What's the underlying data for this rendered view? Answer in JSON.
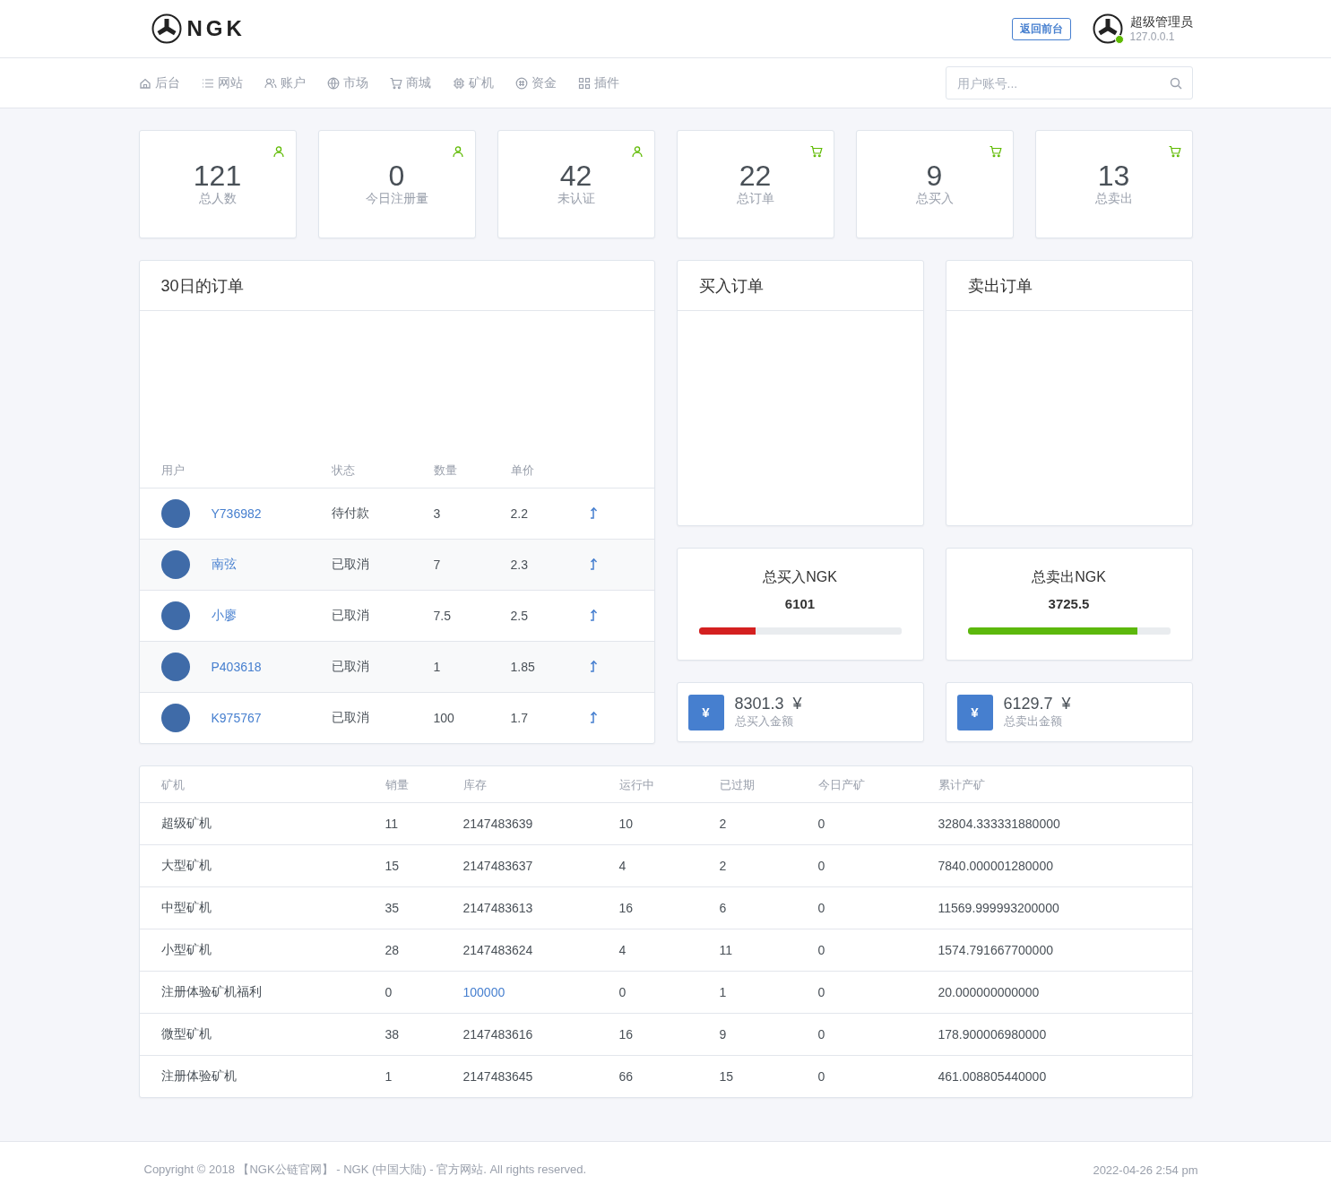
{
  "header": {
    "logo_text": "NGK",
    "back_button": "返回前台",
    "user": {
      "name": "超级管理员",
      "ip": "127.0.0.1",
      "online": true
    }
  },
  "nav": {
    "items": [
      {
        "label": "后台",
        "kind": "home"
      },
      {
        "label": "网站",
        "kind": "list"
      },
      {
        "label": "账户",
        "kind": "users"
      },
      {
        "label": "市场",
        "kind": "globe"
      },
      {
        "label": "商城",
        "kind": "cart"
      },
      {
        "label": "矿机",
        "kind": "chip"
      },
      {
        "label": "资金",
        "kind": "coin"
      },
      {
        "label": "插件",
        "kind": "grid"
      }
    ],
    "search": {
      "placeholder": "用户账号..."
    }
  },
  "stats": [
    {
      "value": "121",
      "label": "总人数",
      "kind": "user"
    },
    {
      "value": "0",
      "label": "今日注册量",
      "kind": "user"
    },
    {
      "value": "42",
      "label": "未认证",
      "kind": "user"
    },
    {
      "value": "22",
      "label": "总订单",
      "kind": "cart"
    },
    {
      "value": "9",
      "label": "总买入",
      "kind": "cart"
    },
    {
      "value": "13",
      "label": "总卖出",
      "kind": "cart"
    }
  ],
  "orders_panel": {
    "title": "30日的订单",
    "columns": [
      "用户",
      "状态",
      "数量",
      "单价"
    ],
    "rows": [
      {
        "user": "Y736982",
        "status": "待付款",
        "quantity": "3",
        "price": "2.2"
      },
      {
        "user": "南弦",
        "status": "已取消",
        "quantity": "7",
        "price": "2.3"
      },
      {
        "user": "小廖",
        "status": "已取消",
        "quantity": "7.5",
        "price": "2.5"
      },
      {
        "user": "P403618",
        "status": "已取消",
        "quantity": "1",
        "price": "1.85"
      },
      {
        "user": "K975767",
        "status": "已取消",
        "quantity": "100",
        "price": "1.7"
      }
    ]
  },
  "side_panels": [
    {
      "title": "买入订单"
    },
    {
      "title": "卖出订单"
    }
  ],
  "totals": [
    {
      "title": "总买入NGK",
      "value": "6101",
      "level": 0.28,
      "color": "#d42020"
    },
    {
      "title": "总卖出NGK",
      "value": "3725.5",
      "level": 0.84,
      "color": "#5cb80c"
    }
  ],
  "amounts": [
    {
      "icon": "¥",
      "value": "8301.3",
      "unit": "¥",
      "label": "总买入金额"
    },
    {
      "icon": "¥",
      "value": "6129.7",
      "unit": "¥",
      "label": "总卖出金额"
    }
  ],
  "miners_table": {
    "columns": [
      "矿机",
      "销量",
      "库存",
      "运行中",
      "已过期",
      "今日产矿",
      "累计产矿"
    ],
    "rows": [
      {
        "name": "超级矿机",
        "sold": "11",
        "stock": "2147483639",
        "stock_highlighted": false,
        "running": "10",
        "expired": "2",
        "today": "0",
        "total": "32804.333331880000"
      },
      {
        "name": "大型矿机",
        "sold": "15",
        "stock": "2147483637",
        "stock_highlighted": false,
        "running": "4",
        "expired": "2",
        "today": "0",
        "total": "7840.000001280000"
      },
      {
        "name": "中型矿机",
        "sold": "35",
        "stock": "2147483613",
        "stock_highlighted": false,
        "running": "16",
        "expired": "6",
        "today": "0",
        "total": "11569.999993200000"
      },
      {
        "name": "小型矿机",
        "sold": "28",
        "stock": "2147483624",
        "stock_highlighted": false,
        "running": "4",
        "expired": "11",
        "today": "0",
        "total": "1574.791667700000"
      },
      {
        "name": "注册体验矿机福利",
        "sold": "0",
        "stock": "100000",
        "stock_highlighted": true,
        "running": "0",
        "expired": "1",
        "today": "0",
        "total": "20.000000000000"
      },
      {
        "name": "微型矿机",
        "sold": "38",
        "stock": "2147483616",
        "stock_highlighted": false,
        "running": "16",
        "expired": "9",
        "today": "0",
        "total": "178.900006980000"
      },
      {
        "name": "注册体验矿机",
        "sold": "1",
        "stock": "2147483645",
        "stock_highlighted": false,
        "running": "66",
        "expired": "15",
        "today": "0",
        "total": "461.008805440000"
      }
    ]
  },
  "footer": {
    "copyright": "Copyright © 2018 【NGK公链官网】 - NGK (中国大陆) - 官方网站. All rights reserved.",
    "date": "2022-04-26 2:54 pm"
  }
}
